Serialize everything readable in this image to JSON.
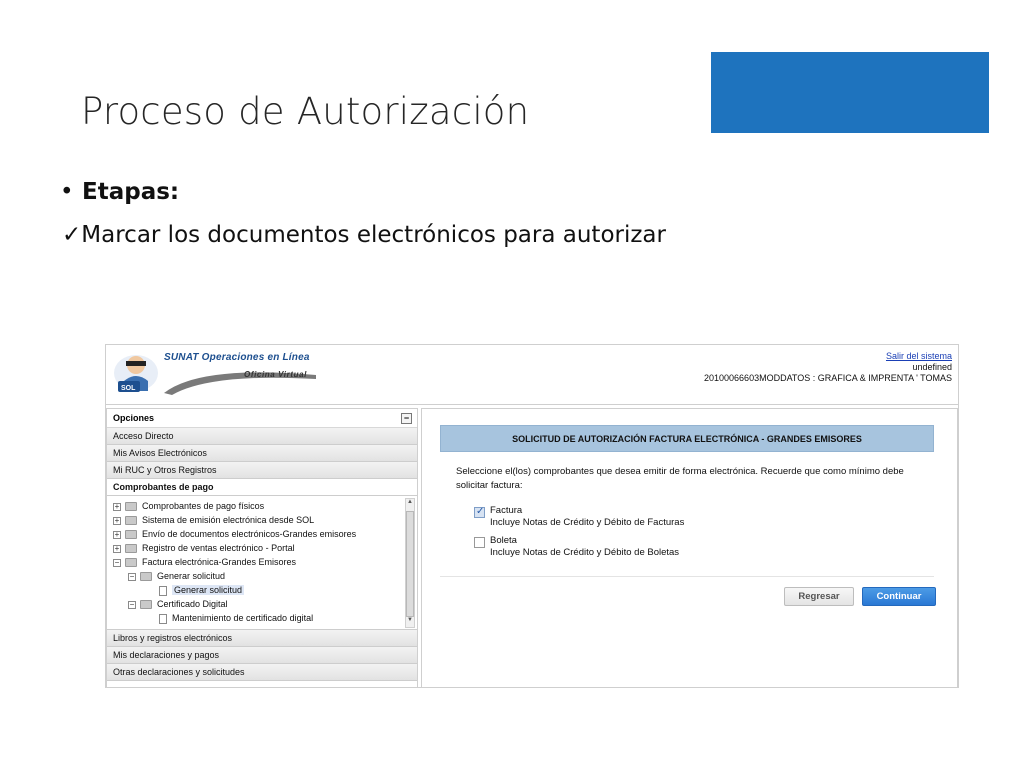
{
  "slide": {
    "title": "Proceso de Autorización",
    "bullet_symbol": "•",
    "bullet_text": "Etapas:",
    "check_symbol": "✓",
    "check_text": "Marcar los documentos electrónicos para autorizar",
    "accent_color": "#1e73be"
  },
  "header": {
    "logo_title": "SUNAT Operaciones en Línea",
    "logo_subtitle": "Oficina Virtual",
    "logo_badge": "SOL",
    "logout_link": "Salir del sistema",
    "user_line1": "undefined",
    "user_line2": "20100066603MODDATOS : GRAFICA & IMPRENTA ' TOMAS"
  },
  "menu": {
    "heading": "Opciones",
    "collapse_symbol": "−",
    "items_top": [
      "Acceso Directo",
      "Mis Avisos Electrónicos",
      "Mi RUC y Otros Registros",
      "Comprobantes de pago"
    ],
    "tree": [
      {
        "label": "Comprobantes de pago físicos",
        "toggle": "+"
      },
      {
        "label": "Sistema de emisión electrónica desde SOL",
        "toggle": "+"
      },
      {
        "label": "Envío de documentos electrónicos-Grandes emisores",
        "toggle": "+"
      },
      {
        "label": "Registro de ventas electrónico - Portal",
        "toggle": "+"
      },
      {
        "label": "Factura electrónica-Grandes Emisores",
        "toggle": "−"
      },
      {
        "label": "Generar solicitud",
        "toggle": "−"
      },
      {
        "label": "Generar solicitud"
      },
      {
        "label": "Certificado Digital",
        "toggle": "−"
      },
      {
        "label": "Mantenimiento de certificado digital"
      }
    ],
    "items_bottom": [
      "Libros y registros electrónicos",
      "Mis declaraciones y pagos",
      "Otras declaraciones y solicitudes"
    ]
  },
  "panel": {
    "title": "SOLICITUD DE AUTORIZACIÓN FACTURA ELECTRÓNICA - GRANDES EMISORES",
    "instructions": "Seleccione el(los) comprobantes que desea emitir de forma electrónica. Recuerde que como mínimo debe solicitar factura:",
    "options": [
      {
        "label": "Factura",
        "detail": "Incluye Notas de Crédito y Débito de Facturas",
        "checked": true
      },
      {
        "label": "Boleta",
        "detail": "Incluye Notas de Crédito y Débito de Boletas",
        "checked": false
      }
    ],
    "back_button": "Regresar",
    "continue_button": "Continuar",
    "title_color": "#a7c4de",
    "button_color": "#2a78d4"
  }
}
